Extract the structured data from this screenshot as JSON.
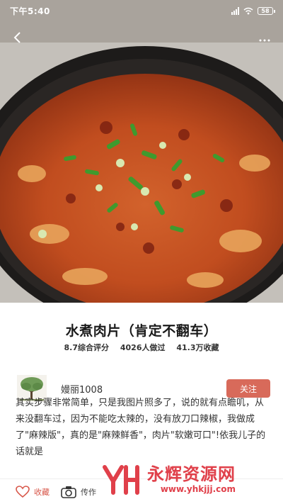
{
  "status_bar": {
    "time": "下午5:40",
    "battery": "58"
  },
  "recipe": {
    "title": "水煮肉片（肯定不翻车）",
    "stats": [
      "8.7综合评分",
      "4026人做过",
      "41.3万收藏"
    ]
  },
  "author": {
    "name": "嫚丽1008",
    "follow_label": "关注"
  },
  "description": "其实步骤非常简单，只是我图片照多了，说的就有点瞻叽，从来没翻车过，因为不能吃太辣的，没有放刀口辣椒，我做成了\"麻辣版\"，真的是\"麻辣鲜香\"，肉片\"软嫩可口\"!依我儿子的话就是",
  "bottom_bar": {
    "favorite_label": "收藏",
    "upload_label": "传作"
  },
  "watermark": {
    "name": "永辉资源网",
    "url": "www.yhkjjj.com"
  },
  "colors": {
    "accent": "#d86a5a",
    "favorite": "#d8574a",
    "watermark": "#e0404a"
  }
}
